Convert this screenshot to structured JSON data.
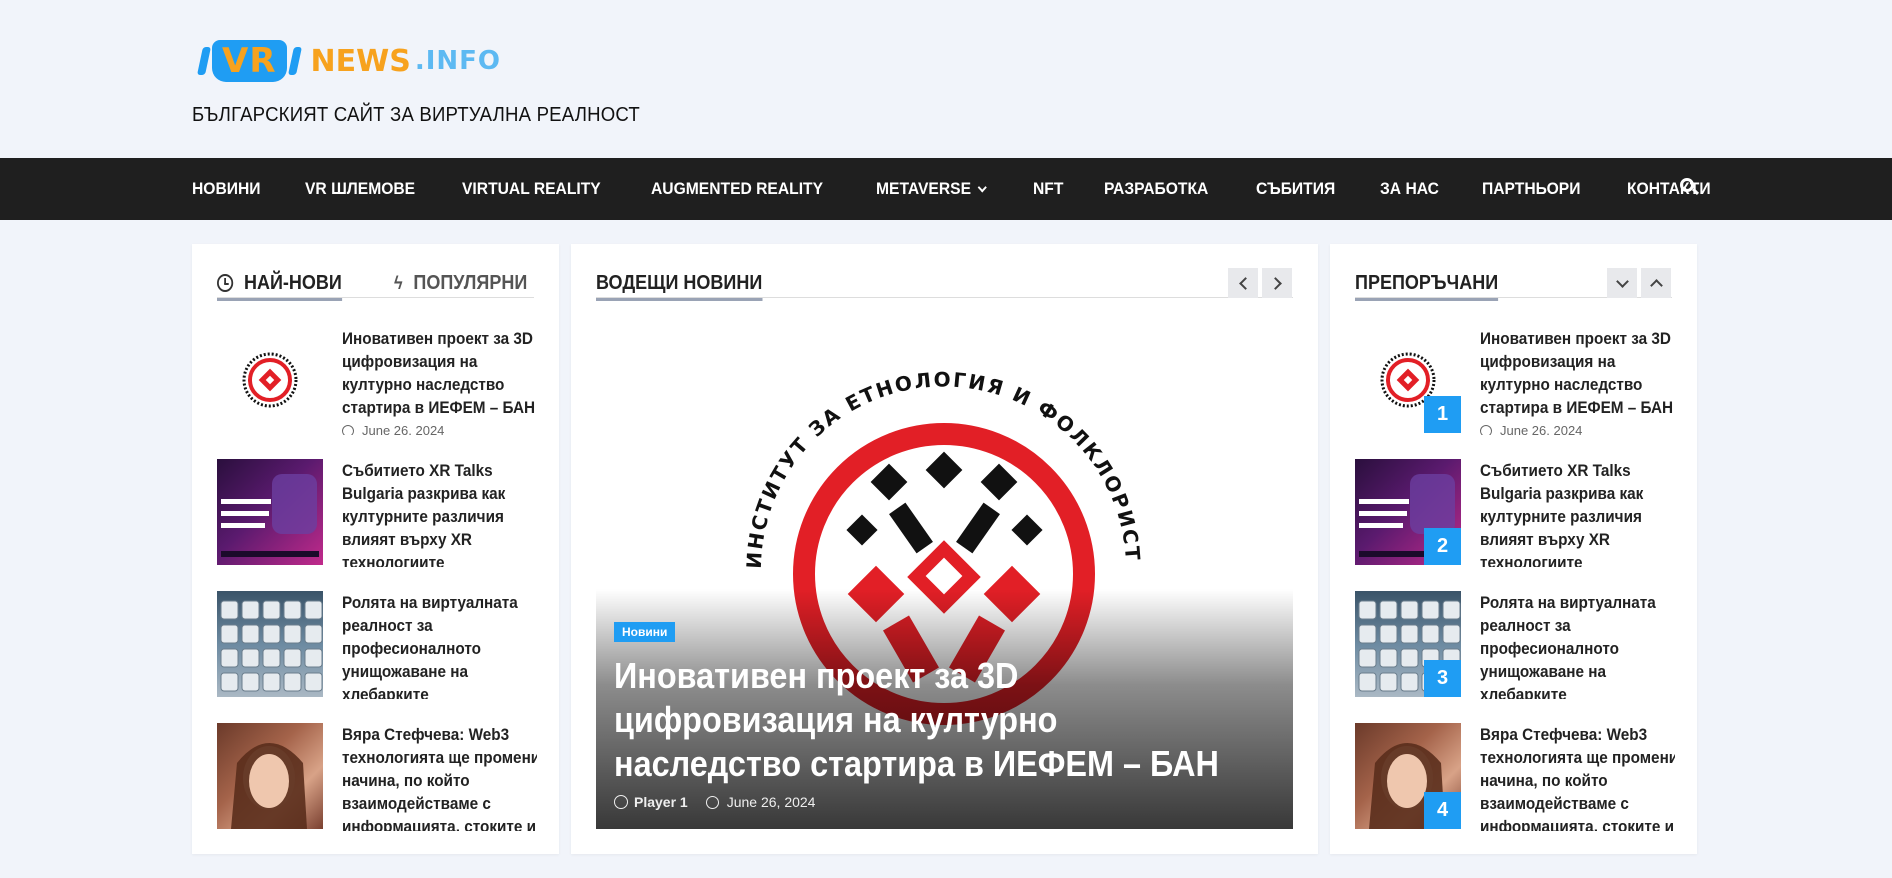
{
  "site": {
    "logo_vr": "VR",
    "logo_news": "NEWS",
    "logo_info": ".INFO",
    "tagline": "БЪЛГАРСКИЯТ САЙТ ЗА ВИРТУАЛНА РЕАЛНОСТ",
    "accent": "#1f9df3",
    "logo_orange": "#f7a21e"
  },
  "nav": {
    "items": [
      "НОВИНИ",
      "VR ШЛЕМОВЕ",
      "VIRTUAL REALITY",
      "AUGMENTED REALITY",
      "METAVERSE",
      "NFT",
      "РАЗРАБОТКА",
      "СЪБИТИЯ",
      "ЗА НАС",
      "ПАРТНЬОРИ",
      "КОНТАКТИ"
    ],
    "dropdown_item": "METAVERSE"
  },
  "left": {
    "tab_latest": "НАЙ-НОВИ",
    "tab_popular": "ПОПУЛЯРНИ",
    "items": [
      {
        "title": "Иновативен проект за 3D цифровизация на културно наследство стартира в ИЕФЕМ – БАН",
        "date": "June 26, 2024",
        "thumb": "ethnology-seal"
      },
      {
        "title": "Събитието XR Talks Bulgaria разкрива как културните различия влияят върху XR технологиите",
        "date": "",
        "thumb": "xr-talks-poster"
      },
      {
        "title": "Ролята на виртуалната реалност за професионалното унищожаване на хлебарките",
        "date": "",
        "thumb": "keyboard"
      },
      {
        "title": "Вяра Стефчева: Web3 технологията ще промени начина, по който взаимодействаме с информацията, стоките и",
        "date": "",
        "thumb": "portrait"
      }
    ]
  },
  "middle": {
    "section_title": "ВОДЕЩИ НОВИНИ",
    "hero": {
      "category": "Новини",
      "title": "Иновативен проект за 3D цифровизация на културно наследство стартира в ИЕФЕМ – БАН",
      "author": "Player 1",
      "date": "June 26, 2024"
    }
  },
  "right": {
    "section_title": "ПРЕПОРЪЧАНИ",
    "items": [
      {
        "rank": "1",
        "title": "Иновативен проект за 3D цифровизация на културно наследство стартира в ИЕФЕМ – БАН",
        "date": "June 26, 2024"
      },
      {
        "rank": "2",
        "title": "Събитието XR Talks Bulgaria разкрива как културните различия влияят върху XR технологиите",
        "date": ""
      },
      {
        "rank": "3",
        "title": "Ролята на виртуалната реалност за професионалното унищожаване на хлебарките",
        "date": ""
      },
      {
        "rank": "4",
        "title": "Вяра Стефчева: Web3 технологията ще промени начина, по който взаимодействаме с информацията, стоките и",
        "date": ""
      }
    ]
  }
}
